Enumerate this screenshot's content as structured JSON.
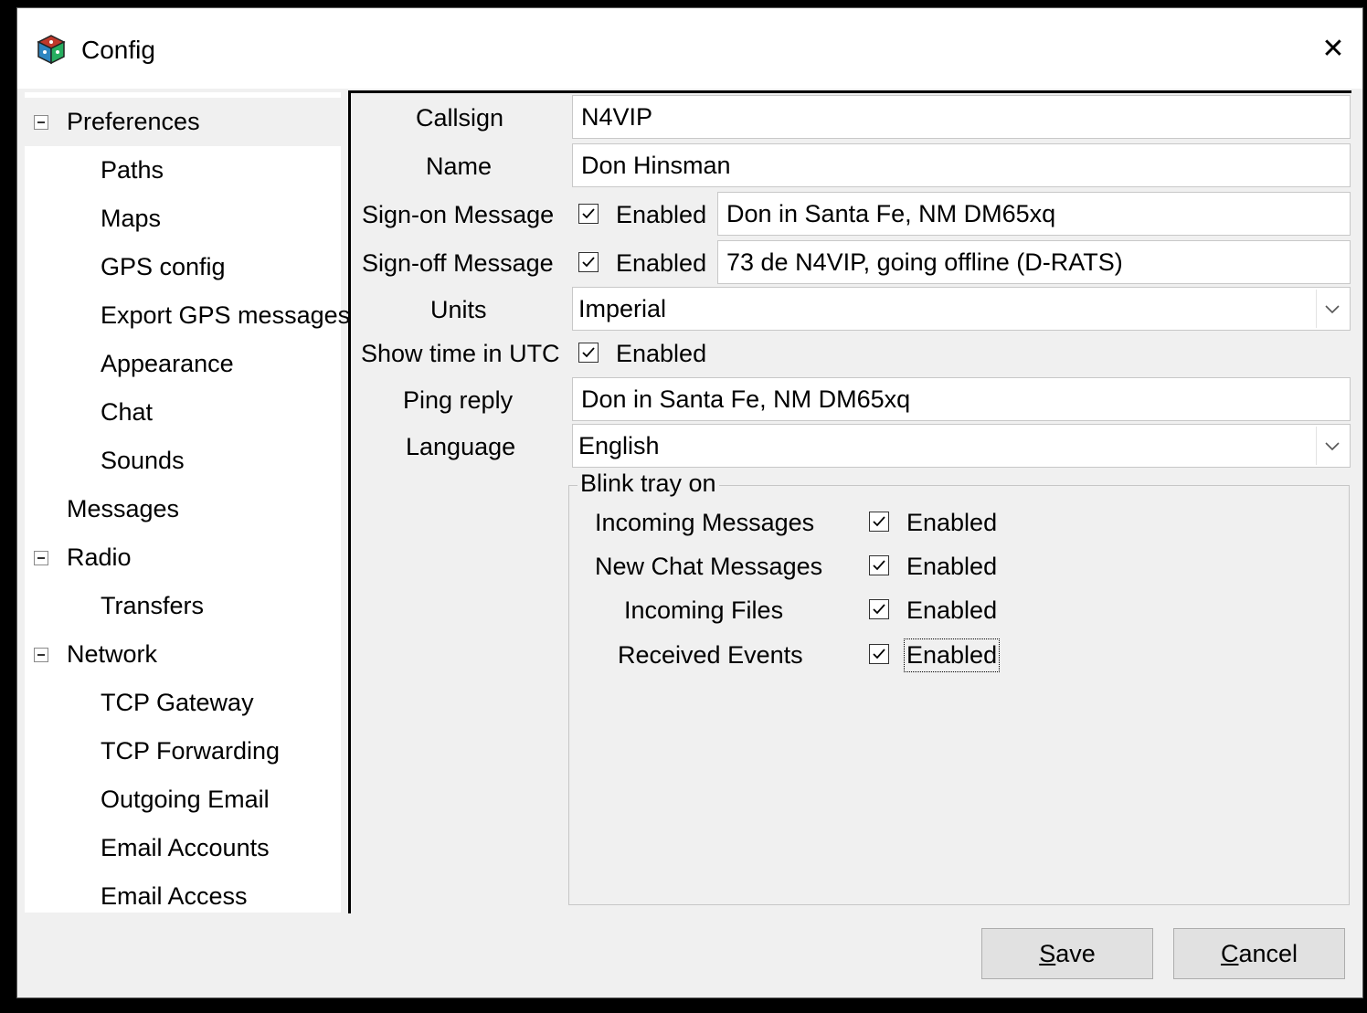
{
  "window": {
    "title": "Config",
    "close_glyph": "✕",
    "app_icon": "dice-cube-icon"
  },
  "sidebar": {
    "items": [
      {
        "label": "Preferences",
        "level": 0,
        "expanded": true,
        "selected": true
      },
      {
        "label": "Paths",
        "level": 1
      },
      {
        "label": "Maps",
        "level": 1
      },
      {
        "label": "GPS config",
        "level": 1
      },
      {
        "label": "Export GPS messages",
        "level": 1
      },
      {
        "label": "Appearance",
        "level": 1
      },
      {
        "label": "Chat",
        "level": 1
      },
      {
        "label": "Sounds",
        "level": 1
      },
      {
        "label": "Messages",
        "level": 0
      },
      {
        "label": "Radio",
        "level": 0,
        "expanded": true
      },
      {
        "label": "Transfers",
        "level": 1
      },
      {
        "label": "Network",
        "level": 0,
        "expanded": true
      },
      {
        "label": "TCP Gateway",
        "level": 1
      },
      {
        "label": "TCP Forwarding",
        "level": 1
      },
      {
        "label": "Outgoing Email",
        "level": 1
      },
      {
        "label": "Email Accounts",
        "level": 1
      },
      {
        "label": "Email Access",
        "level": 1
      }
    ]
  },
  "form": {
    "callsign": {
      "label": "Callsign",
      "value": "N4VIP"
    },
    "name": {
      "label": "Name",
      "value": "Don Hinsman"
    },
    "signon": {
      "label": "Sign-on Message",
      "enabled_label": "Enabled",
      "checked": true,
      "value": "Don in Santa Fe, NM DM65xq"
    },
    "signoff": {
      "label": "Sign-off Message",
      "enabled_label": "Enabled",
      "checked": true,
      "value": "73 de N4VIP, going offline (D-RATS)"
    },
    "units": {
      "label": "Units",
      "value": "Imperial"
    },
    "utc": {
      "label": "Show time in UTC",
      "enabled_label": "Enabled",
      "checked": true
    },
    "ping": {
      "label": "Ping reply",
      "value": "Don in Santa Fe, NM DM65xq"
    },
    "language": {
      "label": "Language",
      "value": "English"
    },
    "blink": {
      "legend": "Blink tray on",
      "rows": [
        {
          "label": "Incoming Messages",
          "enabled_label": "Enabled",
          "checked": true
        },
        {
          "label": "New Chat Messages",
          "enabled_label": "Enabled",
          "checked": true
        },
        {
          "label": "Incoming Files",
          "enabled_label": "Enabled",
          "checked": true
        },
        {
          "label": "Received Events",
          "enabled_label": "Enabled",
          "checked": true
        }
      ]
    }
  },
  "buttons": {
    "save_mnemonic": "S",
    "save_rest": "ave",
    "cancel_mnemonic": "C",
    "cancel_rest": "ancel"
  }
}
